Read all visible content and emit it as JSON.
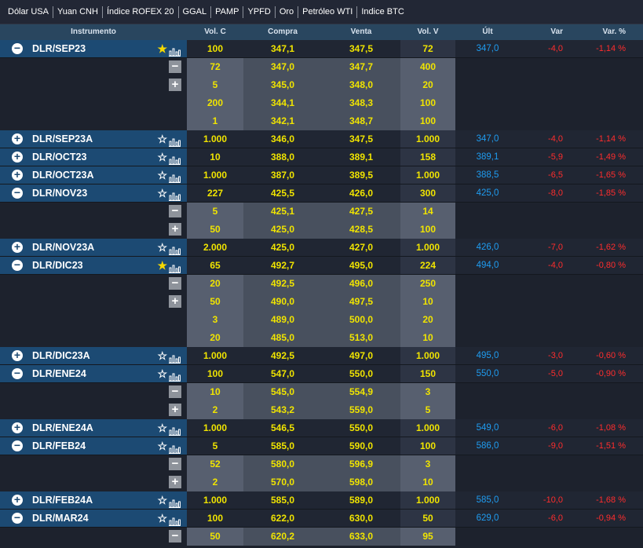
{
  "tabs": [
    "Dólar USA",
    "Yuan CNH",
    "Índice ROFEX 20",
    "GGAL",
    "PAMP",
    "YPFD",
    "Oro",
    "Petróleo WTI",
    "Indice BTC"
  ],
  "headers": {
    "instrumento": "Instrumento",
    "volc": "Vol. C",
    "compra": "Compra",
    "venta": "Venta",
    "volv": "Vol. V",
    "ult": "Últ",
    "var": "Var",
    "varp": "Var. %"
  },
  "colors": {
    "instrument_bg": "#1c4a73",
    "yellow_values": "#f0e400",
    "last_price": "#1f9cf0",
    "negative": "#ff2d2d",
    "star_active": "#f5d800"
  },
  "rows": [
    {
      "name": "DLR/SEP23",
      "expanded": true,
      "fav": true,
      "volc": "100",
      "compra": "347,1",
      "venta": "347,5",
      "volv": "72",
      "ult": "347,0",
      "var": "-4,0",
      "varp": "-1,14 %",
      "depth": [
        [
          "72",
          "347,0",
          "347,7",
          "400"
        ],
        [
          "5",
          "345,0",
          "348,0",
          "20"
        ],
        [
          "200",
          "344,1",
          "348,3",
          "100"
        ],
        [
          "1",
          "342,1",
          "348,7",
          "100"
        ]
      ]
    },
    {
      "name": "DLR/SEP23A",
      "expanded": false,
      "fav": false,
      "volc": "1.000",
      "compra": "346,0",
      "venta": "347,5",
      "volv": "1.000",
      "ult": "347,0",
      "var": "-4,0",
      "varp": "-1,14 %",
      "depth": []
    },
    {
      "name": "DLR/OCT23",
      "expanded": false,
      "fav": false,
      "volc": "10",
      "compra": "388,0",
      "venta": "389,1",
      "volv": "158",
      "ult": "389,1",
      "var": "-5,9",
      "varp": "-1,49 %",
      "depth": []
    },
    {
      "name": "DLR/OCT23A",
      "expanded": false,
      "fav": false,
      "volc": "1.000",
      "compra": "387,0",
      "venta": "389,5",
      "volv": "1.000",
      "ult": "388,5",
      "var": "-6,5",
      "varp": "-1,65 %",
      "depth": []
    },
    {
      "name": "DLR/NOV23",
      "expanded": true,
      "fav": false,
      "volc": "227",
      "compra": "425,5",
      "venta": "426,0",
      "volv": "300",
      "ult": "425,0",
      "var": "-8,0",
      "varp": "-1,85 %",
      "depth": [
        [
          "5",
          "425,1",
          "427,5",
          "14"
        ],
        [
          "50",
          "425,0",
          "428,5",
          "100"
        ]
      ]
    },
    {
      "name": "DLR/NOV23A",
      "expanded": false,
      "fav": false,
      "volc": "2.000",
      "compra": "425,0",
      "venta": "427,0",
      "volv": "1.000",
      "ult": "426,0",
      "var": "-7,0",
      "varp": "-1,62 %",
      "depth": []
    },
    {
      "name": "DLR/DIC23",
      "expanded": true,
      "fav": true,
      "volc": "65",
      "compra": "492,7",
      "venta": "495,0",
      "volv": "224",
      "ult": "494,0",
      "var": "-4,0",
      "varp": "-0,80 %",
      "depth": [
        [
          "20",
          "492,5",
          "496,0",
          "250"
        ],
        [
          "50",
          "490,0",
          "497,5",
          "10"
        ],
        [
          "3",
          "489,0",
          "500,0",
          "20"
        ],
        [
          "20",
          "485,0",
          "513,0",
          "10"
        ]
      ]
    },
    {
      "name": "DLR/DIC23A",
      "expanded": false,
      "fav": false,
      "volc": "1.000",
      "compra": "492,5",
      "venta": "497,0",
      "volv": "1.000",
      "ult": "495,0",
      "var": "-3,0",
      "varp": "-0,60 %",
      "depth": []
    },
    {
      "name": "DLR/ENE24",
      "expanded": true,
      "fav": false,
      "volc": "100",
      "compra": "547,0",
      "venta": "550,0",
      "volv": "150",
      "ult": "550,0",
      "var": "-5,0",
      "varp": "-0,90 %",
      "depth": [
        [
          "10",
          "545,0",
          "554,9",
          "3"
        ],
        [
          "2",
          "543,2",
          "559,0",
          "5"
        ]
      ]
    },
    {
      "name": "DLR/ENE24A",
      "expanded": false,
      "fav": false,
      "volc": "1.000",
      "compra": "546,5",
      "venta": "550,0",
      "volv": "1.000",
      "ult": "549,0",
      "var": "-6,0",
      "varp": "-1,08 %",
      "depth": []
    },
    {
      "name": "DLR/FEB24",
      "expanded": true,
      "fav": false,
      "volc": "5",
      "compra": "585,0",
      "venta": "590,0",
      "volv": "100",
      "ult": "586,0",
      "var": "-9,0",
      "varp": "-1,51 %",
      "depth": [
        [
          "52",
          "580,0",
          "596,9",
          "3"
        ],
        [
          "2",
          "570,0",
          "598,0",
          "10"
        ]
      ]
    },
    {
      "name": "DLR/FEB24A",
      "expanded": false,
      "fav": false,
      "volc": "1.000",
      "compra": "585,0",
      "venta": "589,0",
      "volv": "1.000",
      "ult": "585,0",
      "var": "-10,0",
      "varp": "-1,68 %",
      "depth": []
    },
    {
      "name": "DLR/MAR24",
      "expanded": true,
      "fav": false,
      "volc": "100",
      "compra": "622,0",
      "venta": "630,0",
      "volv": "50",
      "ult": "629,0",
      "var": "-6,0",
      "varp": "-0,94 %",
      "depth": [
        [
          "50",
          "620,2",
          "633,0",
          "95"
        ]
      ]
    }
  ]
}
